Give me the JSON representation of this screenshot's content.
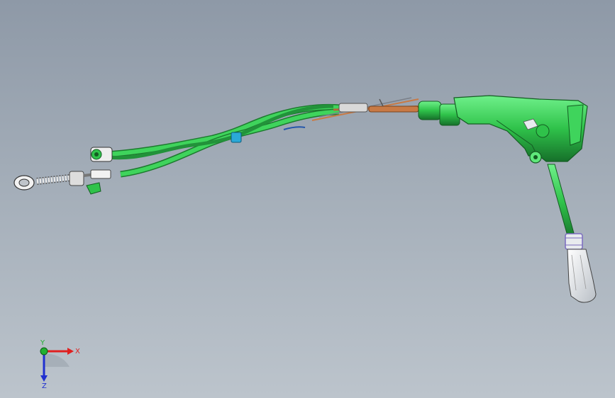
{
  "viewport": {
    "background_top": "#8e99a7",
    "background_bottom": "#bcc4cc"
  },
  "model": {
    "name_icon": "gear-shift-cable-assembly",
    "body_color": "#2fc24a",
    "body_highlight": "#5fe87a",
    "body_shadow": "#1c8a30",
    "cable_color": "#c87a45",
    "clip_color": "#2aa9d8",
    "knob_color": "#e8ebee",
    "boot_color": "#7a6bbf"
  },
  "triad": {
    "x_label": "X",
    "y_label": "Y",
    "z_label": "Z",
    "x_color": "#e02020",
    "y_color": "#20b030",
    "z_color": "#2030d0"
  }
}
